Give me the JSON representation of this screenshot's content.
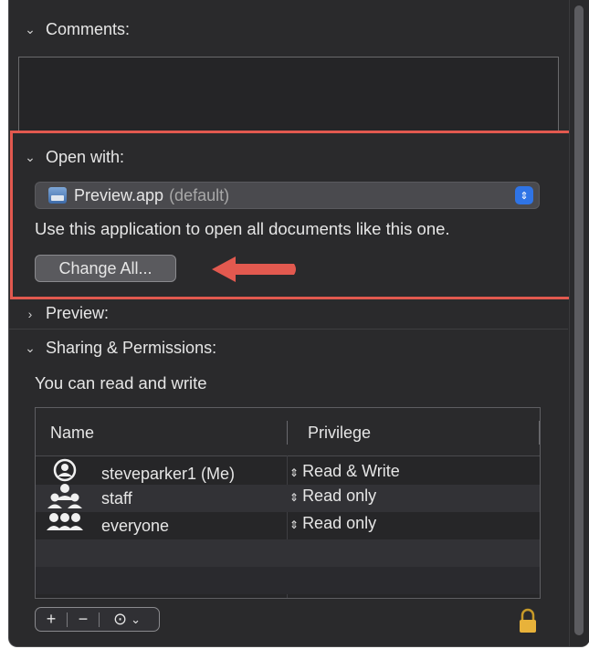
{
  "sections": {
    "comments": {
      "label": "Comments:",
      "expanded": true
    },
    "open_with": {
      "label": "Open with:",
      "expanded": true,
      "app_name": "Preview.app",
      "app_default": "(default)",
      "description": "Use this application to open all documents like this one.",
      "change_all_label": "Change All..."
    },
    "preview": {
      "label": "Preview:",
      "expanded": false
    },
    "sharing": {
      "label": "Sharing & Permissions:",
      "expanded": true,
      "access_text": "You can read and write",
      "columns": {
        "name": "Name",
        "privilege": "Privilege"
      },
      "rows": [
        {
          "name": "steveparker1 (Me)",
          "privilege": "Read & Write",
          "icon": "user-icon"
        },
        {
          "name": "staff",
          "privilege": "Read only",
          "icon": "group-icon"
        },
        {
          "name": "everyone",
          "privilege": "Read only",
          "icon": "everyone-icon"
        }
      ]
    }
  },
  "toolbar": {
    "add": "+",
    "remove": "−",
    "action": "⊙"
  },
  "colors": {
    "highlight": "#e2594f",
    "accent": "#2f74e6",
    "background": "#2a2a2c"
  }
}
